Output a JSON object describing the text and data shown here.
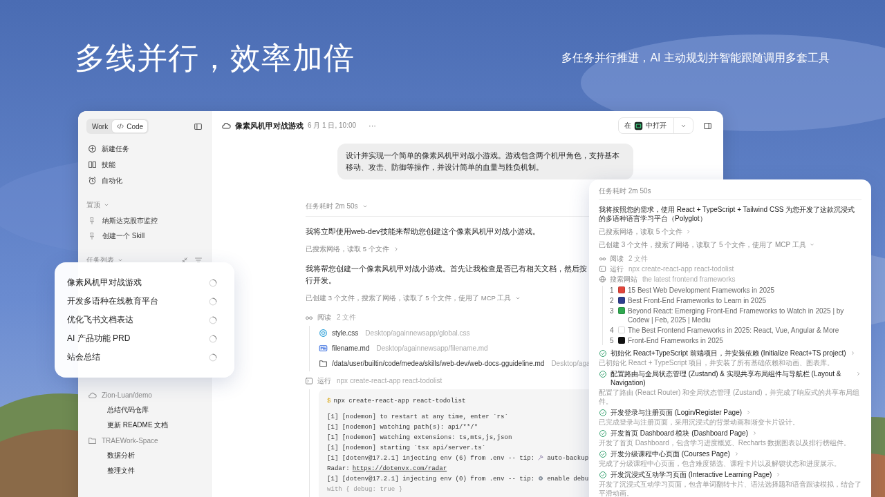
{
  "headline": {
    "title": "多线并行，效率加倍",
    "subtitle": "多任务并行推进，AI 主动规划并智能跟随调用多套工具"
  },
  "window": {
    "sidebar": {
      "modes": [
        {
          "label": "Work",
          "kind": "text",
          "selected": false
        },
        {
          "label": "Code",
          "kind": "code",
          "selected": true
        }
      ],
      "nav": [
        {
          "label": "新建任务",
          "kind": "new"
        },
        {
          "label": "技能",
          "kind": "skills"
        },
        {
          "label": "自动化",
          "kind": "automation"
        }
      ],
      "pinned": {
        "title": "置顶",
        "expanded": true,
        "items": [
          {
            "label": "纳斯达克股市监控"
          },
          {
            "label": "创建一个 Skill"
          }
        ]
      },
      "tasks": {
        "title": "任务列表",
        "expanded": true,
        "groups": [
          {
            "label": "Zion-Luan/demo",
            "kind": "cloud",
            "children": [
              {
                "label": "总结代码仓库"
              },
              {
                "label": "更新 README 文档"
              }
            ]
          },
          {
            "label": "TRAEWork-Space",
            "kind": "folder",
            "children": [
              {
                "label": "数据分析"
              },
              {
                "label": "整理文件"
              }
            ]
          }
        ]
      }
    },
    "header": {
      "title": "像素风机甲对战游戏",
      "date": "6 月 1 日, 10:00",
      "more": "···",
      "open_button": {
        "before": "在",
        "after": "中打开"
      }
    },
    "chat": {
      "prompt": "设计并实现一个简单的像素风机甲对战小游戏。游戏包含两个机甲角色，支持基本移动、攻击、防御等操作，并设计简单的血量与胜负机制。",
      "duration": {
        "label": "任务耗时 2m 50s",
        "expanded": true
      },
      "messages": [
        {
          "kind": "text",
          "lines": [
            "我将立即使用web-dev技能来帮助您创建这个像素风机甲对战小游戏。"
          ]
        },
        {
          "kind": "summary",
          "text": "已搜索网络，读取 5 个文件",
          "expanded": false
        },
        {
          "kind": "text",
          "lines": [
            "我将帮您创建一个像素风机甲对战小游戏。首先让我检查是否已有相关文档，然后按",
            "行开发。"
          ]
        },
        {
          "kind": "summary",
          "text": "已创建 3 个文件，搜索了网络，读取了 5 个文件，使用了 MCP 工具",
          "expanded": true
        }
      ],
      "steps": [
        {
          "kind": "read",
          "label": "阅读",
          "detail": "2 文件",
          "files": [
            {
              "kind": "css",
              "name": "style.css",
              "path": "Desktop/againnewsapp/global.css"
            },
            {
              "kind": "markdown",
              "name": "filename.md",
              "path": "Desktop/againnewsapp/filename.md"
            },
            {
              "kind": "folder",
              "name": "/data/user/builtin/code/medea/skills/web-dev/web-docs-gguideline.md",
              "path": "Desktop/aga"
            }
          ]
        },
        {
          "kind": "run",
          "label": "运行",
          "detail": "npx create-react-app react-todolist",
          "terminal": {
            "prompt": "$",
            "command": "npx create-react-app react-todolist",
            "lines": [
              {
                "kind": "plain",
                "text": "[1] [nodemon] to restart at any time, enter `rs`"
              },
              {
                "kind": "plain",
                "text": "[1] [nodemon] watching path(s): api/**/*"
              },
              {
                "kind": "plain",
                "text": "[1] [nodemon] watching extensions: ts,mts,js,json"
              },
              {
                "kind": "plain",
                "text": "[1] [nodemon] starting `tsx api/server.ts`"
              },
              {
                "kind": "tip_tool",
                "text": "[1] [dotenv@17.2.1] injecting env (6) from .env -- tip:",
                "after": "auto-backup"
              },
              {
                "kind": "link",
                "text": "Radar:",
                "link": "https://dotenvx.com/radar"
              },
              {
                "kind": "tip_gear",
                "text": "[1] [dotenv@17.2.1] injecting env (0) from .env -- tip:",
                "after": "enable debu"
              },
              {
                "kind": "faint",
                "text": "with { debug: true }"
              }
            ]
          }
        }
      ]
    }
  },
  "task_card": {
    "items": [
      {
        "label": "像素风机甲对战游戏"
      },
      {
        "label": "开发多语种在线教育平台"
      },
      {
        "label": "优化飞书文档表达"
      },
      {
        "label": "AI 产品功能 PRD"
      },
      {
        "label": "站会总结"
      }
    ]
  },
  "detail_panel": {
    "duration": "任务耗时 2m 50s",
    "intro": "我将按照您的需求，使用 React + TypeScript + Tailwind CSS 为您开发了这款沉浸式的多语种语言学习平台（Polyglot）",
    "summaries": [
      {
        "text": "已搜索网络，读取 5 个文件",
        "expanded": false
      },
      {
        "text": "已创建 3 个文件，搜索了网络，读取了 5 个文件，使用了 MCP 工具",
        "expanded": true
      }
    ],
    "steps": [
      {
        "kind": "read",
        "label": "阅读",
        "detail": "2 文件"
      },
      {
        "kind": "run",
        "label": "运行",
        "detail": "npx create-react-app react-todolist"
      },
      {
        "kind": "search",
        "label": "搜索网站",
        "detail": "the latest frontend frameworks",
        "results": [
          {
            "number": "1",
            "title": "15 Best Web Development Frameworks in 2025",
            "color": "#e2463c"
          },
          {
            "number": "2",
            "title": "Best Front-End Frameworks to Learn in 2025",
            "color": "#2e3f8f"
          },
          {
            "number": "3",
            "title": "Beyond React: Emerging Front-End Frameworks to Watch in 2025 | by Codew | Feb, 2025 | Mediu",
            "color": "#2fa84f"
          },
          {
            "number": "4",
            "title": "The Best Frontend Frameworks in 2025: React, Vue, Angular & More",
            "color": "#ffffff"
          },
          {
            "number": "5",
            "title": "Front-End Frameworks in 2025",
            "color": "#111111"
          }
        ]
      }
    ],
    "tasks": [
      {
        "title": "初始化 React+TypeScript 前端项目，并安装依赖 (Initialize React+TS project)",
        "description": "已初始化 React + TypeScript 项目，并安装了所有基础依赖和动画、图表库。",
        "done": true,
        "expanded": false
      },
      {
        "title": "配置路由与全局状态管理 (Zustand) & 实现共享布局组件与导航栏 (Layout & Navigation)",
        "description": "配置了路由 (React Router) 和全局状态管理 (Zustand)，并完成了响应式的共享布局组件。",
        "done": true,
        "expanded": false
      },
      {
        "title": "开发登录与注册页面 (Login/Register Page)",
        "description": "已完成登录与注册页面，采用沉浸式的背景动画和渐变卡片设计。",
        "done": true,
        "expanded": false
      },
      {
        "title": "开发首页 Dashboard 模块 (Dashboard Page)",
        "description": "开发了首页 Dashboard，包含学习进度概览、Recharts 数据图表以及排行榜组件。",
        "done": true,
        "expanded": false
      },
      {
        "title": "开发分级课程中心页面 (Courses Page)",
        "description": "完成了分级课程中心页面，包含难度筛选、课程卡片以及解锁状态和进度展示。",
        "done": true,
        "expanded": false
      },
      {
        "title": "开发沉浸式互动学习页面 (Interactive Learning Page)",
        "description": "开发了沉浸式互动学习页面，包含单词翻转卡片、语法选择题和语音跟读模拟，结合了平滑动画。",
        "done": true,
        "expanded": false
      }
    ]
  }
}
